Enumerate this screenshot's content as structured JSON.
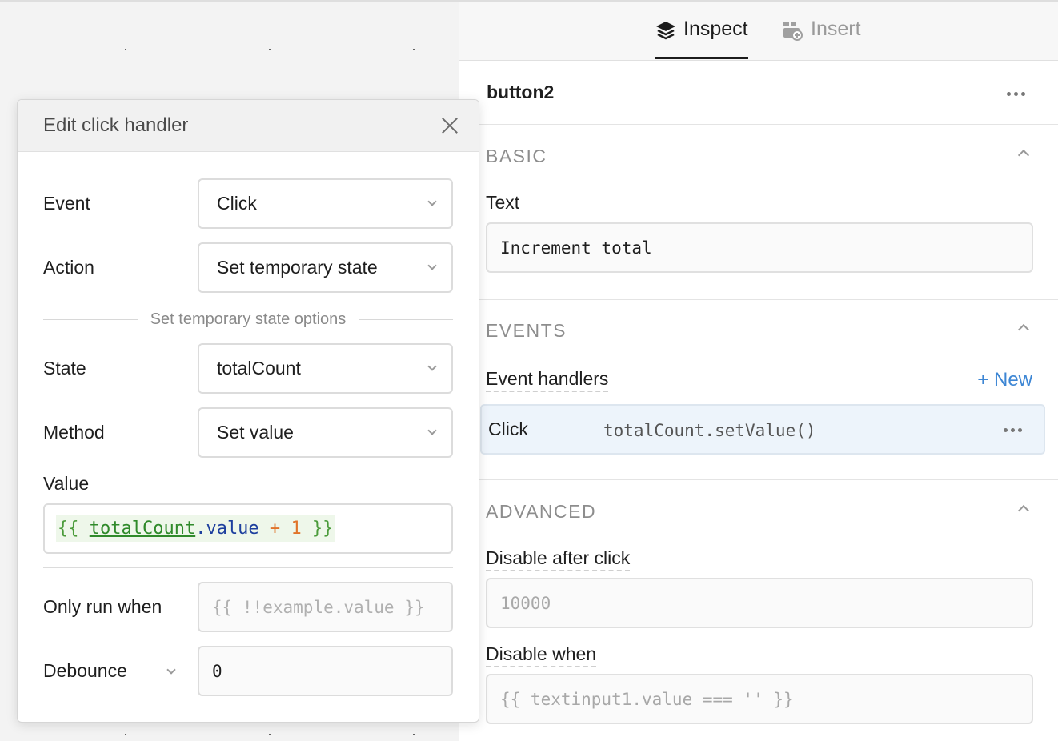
{
  "tabs": [
    {
      "label": "Inspect",
      "icon": "layers-icon",
      "active": true
    },
    {
      "label": "Insert",
      "icon": "insert-component-icon",
      "active": false
    }
  ],
  "component": {
    "name": "button2"
  },
  "sections": {
    "basic": {
      "title": "BASIC",
      "text_label": "Text",
      "text_value": "Increment total"
    },
    "events": {
      "title": "EVENTS",
      "handlers_label": "Event handlers",
      "new_label": "+ New",
      "handler": {
        "event": "Click",
        "action": "totalCount.setValue()"
      }
    },
    "advanced": {
      "title": "ADVANCED",
      "disable_after_click_label": "Disable after click",
      "disable_after_click_placeholder": "10000",
      "disable_when_label": "Disable when",
      "disable_when_placeholder": "{{ textinput1.value === '' }}"
    }
  },
  "dialog": {
    "title": "Edit click handler",
    "event_label": "Event",
    "event_value": "Click",
    "action_label": "Action",
    "action_value": "Set temporary state",
    "options_divider": "Set temporary state options",
    "state_label": "State",
    "state_value": "totalCount",
    "method_label": "Method",
    "method_value": "Set value",
    "value_label": "Value",
    "value_tokens": {
      "open": "{{ ",
      "ident": "totalCount",
      "prop": ".value",
      "op": " + ",
      "num": "1",
      "close": " }}"
    },
    "only_run_when_label": "Only run when",
    "only_run_when_placeholder": "{{ !!example.value }}",
    "debounce_label": "Debounce",
    "debounce_value": "0"
  },
  "colors": {
    "link": "#3d86d4",
    "handler_row_bg": "#edf4fb",
    "code_bg": "#eef7ea"
  }
}
